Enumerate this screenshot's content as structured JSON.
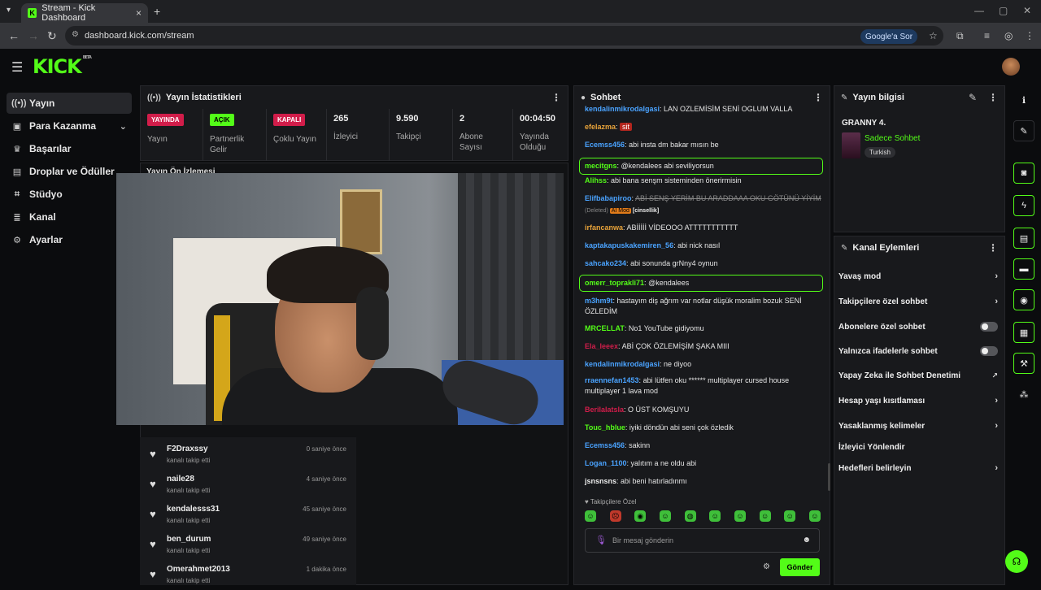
{
  "browser": {
    "tab_title": "Stream - Kick Dashboard",
    "url": "dashboard.kick.com/stream",
    "google_button": "Google'a Sor"
  },
  "app": {
    "logo": "KICK",
    "logo_badge": "BETA"
  },
  "sidebar": {
    "items": [
      {
        "label": "Yayın",
        "icon": "broadcast-icon"
      },
      {
        "label": "Para Kazanma",
        "icon": "money-icon"
      },
      {
        "label": "Başarılar",
        "icon": "trophy-icon"
      },
      {
        "label": "Droplar ve Ödüller",
        "icon": "gift-icon"
      },
      {
        "label": "Stüdyo",
        "icon": "studio-icon"
      },
      {
        "label": "Kanal",
        "icon": "channel-icon"
      },
      {
        "label": "Ayarlar",
        "icon": "gear-icon"
      }
    ]
  },
  "stats_panel": {
    "title": "Yayın İstatistikleri",
    "stats": [
      {
        "badge": "YAYINDA",
        "label": "Yayın"
      },
      {
        "badge": "AÇIK",
        "label": "Partnerlik Gelir"
      },
      {
        "badge": "KAPALI",
        "label": "Çoklu Yayın"
      },
      {
        "value": "265",
        "label": "İzleyici"
      },
      {
        "value": "9.590",
        "label": "Takipçi"
      },
      {
        "value": "2",
        "label": "Abone Sayısı"
      },
      {
        "value": "00:04:50",
        "label": "Yayında Olduğu"
      }
    ]
  },
  "preview": {
    "title": "Yayın Ön İzlemesi"
  },
  "followers": [
    {
      "name": "F2Draxssy",
      "sub": "kanalı takip etti",
      "time": "0 saniye önce"
    },
    {
      "name": "naile28",
      "sub": "kanalı takip etti",
      "time": "4 saniye önce"
    },
    {
      "name": "kendalesss31",
      "sub": "kanalı takip etti",
      "time": "45 saniye önce"
    },
    {
      "name": "ben_durum",
      "sub": "kanalı takip etti",
      "time": "49 saniye önce"
    },
    {
      "name": "Omerahmet2013",
      "sub": "kanalı takip etti",
      "time": "1 dakika önce"
    }
  ],
  "chat": {
    "title": "Sohbet",
    "messages": [
      {
        "user": "kendalinmikrodalgasi",
        "color": "#4aa3ff",
        "text": "LAN OZLEMİSİM SENİ OGLUM VALLA"
      },
      {
        "user": "efelazma",
        "color": "#e8a33a",
        "text": "sit"
      },
      {
        "user": "Ecemss456",
        "color": "#4aa3ff",
        "text": "abi insta dm bakar mısın be"
      },
      {
        "user": "mecitgns",
        "color": "#53fc18",
        "text": "@kendalees abi seviliyorsun"
      },
      {
        "user": "Alihss",
        "color": "#53fc18",
        "text": "abi bana senşm sisteminden önerirmisin"
      },
      {
        "user": "Elifbabapiroo",
        "color": "#4aa3ff",
        "text": "ABİ SENŞ YERİM BU ARADDAAA OKU GÖTÜNÜ YİYİM",
        "deleted": "(Deleted)",
        "ai": "AI Mod",
        "cat": "[cinsellik]"
      },
      {
        "user": "irfancanwa",
        "color": "#e8a33a",
        "text": "ABİİİİİ VİDEOOO ATTTTTTTTTTT"
      },
      {
        "user": "kaptakapuskakemiren_56",
        "color": "#4aa3ff",
        "text": "abi nick nasıl"
      },
      {
        "user": "sahcako234",
        "color": "#4aa3ff",
        "text": "abi sonunda grNny4 oynun"
      },
      {
        "user": "omerr_toprakli71",
        "color": "#53fc18",
        "text": "@kendalees"
      },
      {
        "user": "m3hm9t",
        "color": "#4aa3ff",
        "text": "hastayım diş ağrım var notlar düşük moralim bozuk SENİ ÖZLEDİM"
      },
      {
        "user": "MRCELLAT",
        "color": "#53fc18",
        "text": "No1 YouTube gidiyomu"
      },
      {
        "user": "Ela_leeex",
        "color": "#d11d4a",
        "text": "ABİ ÇOK ÖZLEMİŞİM ŞAKA MIII"
      },
      {
        "user": "kendalinmikrodalgasi",
        "color": "#4aa3ff",
        "text": "ne diyoo"
      },
      {
        "user": "rraennefan1453",
        "color": "#4aa3ff",
        "text": "abi lütfen oku ****** multiplayer cursed house multiplayer 1 lava mod"
      },
      {
        "user": "Berilalatsla",
        "color": "#d11d4a",
        "text": "O ÜST KOMŞUYU"
      },
      {
        "user": "Touc_hblue",
        "color": "#53fc18",
        "text": "iyiki döndün abi seni çok özledik"
      },
      {
        "user": "Ecemss456",
        "color": "#4aa3ff",
        "text": "sakinn"
      },
      {
        "user": "Logan_1100",
        "color": "#4aa3ff",
        "text": "yalıtım a ne oldu abi"
      },
      {
        "user": "jsnsnsns",
        "color": "#eeeeee",
        "text": "abi beni hatırladınmı"
      }
    ],
    "follow_only": "Takipçilere Özel",
    "placeholder": "Bir mesaj gönderin",
    "send_label": "Gönder"
  },
  "stream_info": {
    "title": "Yayın bilgisi",
    "stream_title": "GRANNY 4.",
    "category": "Sadece Sohbet",
    "tag": "Turkish"
  },
  "channel_actions": {
    "title": "Kanal Eylemleri",
    "items": [
      {
        "label": "Yavaş mod",
        "control": "chevron"
      },
      {
        "label": "Takipçilere özel sohbet",
        "control": "chevron"
      },
      {
        "label": "Abonelere özel sohbet",
        "control": "toggle"
      },
      {
        "label": "Yalnızca ifadelerle sohbet",
        "control": "toggle"
      },
      {
        "label": "Yapay Zeka ile Sohbet Denetimi",
        "control": "external"
      },
      {
        "label": "Hesap yaşı kısıtlaması",
        "control": "chevron"
      },
      {
        "label": "Yasaklanmış kelimeler",
        "control": "chevron"
      },
      {
        "label": "İzleyici Yönlendir",
        "control": "none"
      },
      {
        "label": "Hedefleri belirleyin",
        "control": "chevron"
      }
    ]
  },
  "colors": {
    "accent": "#53fc18",
    "live": "#d11d4a",
    "bg": "#0b0c0e",
    "panel": "#18191c"
  }
}
